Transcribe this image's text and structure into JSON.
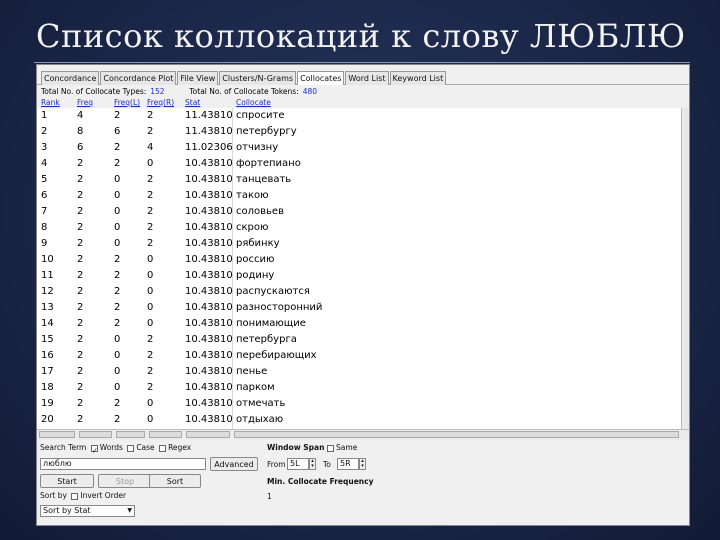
{
  "slide": {
    "title": "Список коллокаций к слову ЛЮБЛЮ"
  },
  "tabs": [
    "Concordance",
    "Concordance Plot",
    "File View",
    "Clusters/N-Grams",
    "Collocates",
    "Word List",
    "Keyword List"
  ],
  "active_tab": 4,
  "stats": {
    "types_label": "Total No. of Collocate Types:",
    "types_value": "152",
    "tokens_label": "Total No. of Collocate Tokens:",
    "tokens_value": "480"
  },
  "columns": [
    "Rank",
    "Freq",
    "Freq(L)",
    "Freq(R)",
    "Stat",
    "Collocate"
  ],
  "rows": [
    [
      "1",
      "4",
      "2",
      "2",
      "11.43810",
      "спросите"
    ],
    [
      "2",
      "8",
      "6",
      "2",
      "11.43810",
      "петербургу"
    ],
    [
      "3",
      "6",
      "2",
      "4",
      "11.02306",
      "отчизну"
    ],
    [
      "4",
      "2",
      "2",
      "0",
      "10.43810",
      "фортепиано"
    ],
    [
      "5",
      "2",
      "0",
      "2",
      "10.43810",
      "танцевать"
    ],
    [
      "6",
      "2",
      "0",
      "2",
      "10.43810",
      "такою"
    ],
    [
      "7",
      "2",
      "0",
      "2",
      "10.43810",
      "соловьев"
    ],
    [
      "8",
      "2",
      "0",
      "2",
      "10.43810",
      "скрою"
    ],
    [
      "9",
      "2",
      "0",
      "2",
      "10.43810",
      "рябинку"
    ],
    [
      "10",
      "2",
      "2",
      "0",
      "10.43810",
      "россию"
    ],
    [
      "11",
      "2",
      "2",
      "0",
      "10.43810",
      "родину"
    ],
    [
      "12",
      "2",
      "2",
      "0",
      "10.43810",
      "распускаются"
    ],
    [
      "13",
      "2",
      "2",
      "0",
      "10.43810",
      "разносторонний"
    ],
    [
      "14",
      "2",
      "2",
      "0",
      "10.43810",
      "понимающие"
    ],
    [
      "15",
      "2",
      "0",
      "2",
      "10.43810",
      "петербурга"
    ],
    [
      "16",
      "2",
      "0",
      "2",
      "10.43810",
      "перебирающих"
    ],
    [
      "17",
      "2",
      "0",
      "2",
      "10.43810",
      "пенье"
    ],
    [
      "18",
      "2",
      "0",
      "2",
      "10.43810",
      "парком"
    ],
    [
      "19",
      "2",
      "2",
      "0",
      "10.43810",
      "отмечать"
    ],
    [
      "20",
      "2",
      "2",
      "0",
      "10.43810",
      "отдыхаю"
    ]
  ],
  "controls": {
    "search_term_label": "Search Term",
    "words_label": "Words",
    "case_label": "Case",
    "regex_label": "Regex",
    "search_value": "люблю",
    "advanced_label": "Advanced",
    "start_label": "Start",
    "stop_label": "Stop",
    "sort_label": "Sort",
    "sort_by_label": "Sort by",
    "invert_order_label": "Invert Order",
    "sort_select_value": "Sort by Stat",
    "window_span_label": "Window Span",
    "same_label": "Same",
    "from_label": "From",
    "from_value": "5L",
    "to_label": "To",
    "to_value": "5R",
    "min_freq_label": "Min. Collocate Frequency",
    "min_freq_value": "1"
  }
}
